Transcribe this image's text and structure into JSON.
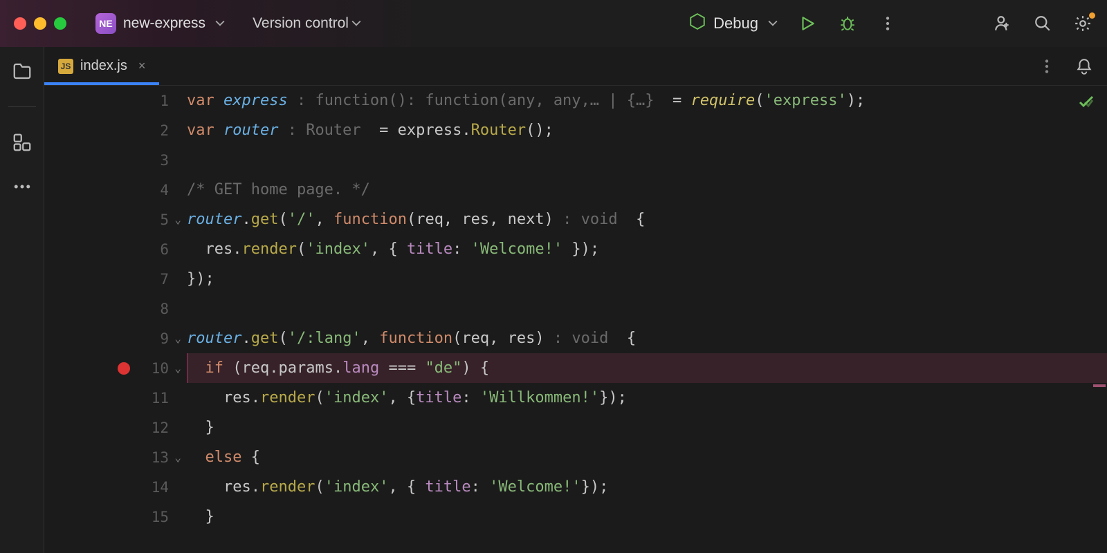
{
  "titlebar": {
    "project_badge": "NE",
    "project_name": "new-express",
    "vcs_label": "Version control",
    "debug_config": "Debug"
  },
  "tab": {
    "badge": "JS",
    "filename": "index.js"
  },
  "code": {
    "lines": [
      "1",
      "2",
      "3",
      "4",
      "5",
      "6",
      "7",
      "8",
      "9",
      "10",
      "11",
      "12",
      "13",
      "14",
      "15"
    ],
    "l1_kw": "var ",
    "l1_var": "express ",
    "l1_hint": ": function(): function(any, any,… | {…}  ",
    "l1_eq": "= ",
    "l1_fn": "require",
    "l1_paren": "(",
    "l1_str": "'express'",
    "l1_end": ");",
    "l2_kw": "var ",
    "l2_var": "router ",
    "l2_hint": ": Router  ",
    "l2_eq": "= ",
    "l2_id": "express",
    "l2_dot": ".",
    "l2_method": "Router",
    "l2_end": "();",
    "l4": "/* GET home page. */",
    "l5_var": "router",
    "l5_dot": ".",
    "l5_method": "get",
    "l5_open": "(",
    "l5_str": "'/'",
    "l5_comma": ", ",
    "l5_fn": "function",
    "l5_args": "(req, res, next) ",
    "l5_hint": ": void  ",
    "l5_brace": "{",
    "l6_indent": "  ",
    "l6_id": "res",
    "l6_dot": ".",
    "l6_method": "render",
    "l6_open": "(",
    "l6_str1": "'index'",
    "l6_comma": ", { ",
    "l6_prop": "title",
    "l6_colon": ": ",
    "l6_str2": "'Welcome!'",
    "l6_end": " });",
    "l7": "});",
    "l9_var": "router",
    "l9_dot": ".",
    "l9_method": "get",
    "l9_open": "(",
    "l9_str": "'/:lang'",
    "l9_comma": ", ",
    "l9_fn": "function",
    "l9_args": "(req, res) ",
    "l9_hint": ": void  ",
    "l9_brace": "{",
    "l10_indent": "  ",
    "l10_kw": "if ",
    "l10_open": "(",
    "l10_id": "req",
    "l10_p1": ".params.",
    "l10_prop": "lang",
    "l10_op": " === ",
    "l10_str": "\"de\"",
    "l10_close": ") {",
    "l11_indent": "    ",
    "l11_id": "res",
    "l11_dot": ".",
    "l11_method": "render",
    "l11_open": "(",
    "l11_str1": "'index'",
    "l11_comma": ", {",
    "l11_prop": "title",
    "l11_colon": ": ",
    "l11_str2": "'Willkommen!'",
    "l11_end": "});",
    "l12": "  }",
    "l13_indent": "  ",
    "l13_kw": "else ",
    "l13_brace": "{",
    "l14_indent": "    ",
    "l14_id": "res",
    "l14_dot": ".",
    "l14_method": "render",
    "l14_open": "(",
    "l14_str1": "'index'",
    "l14_comma": ", { ",
    "l14_prop": "title",
    "l14_colon": ": ",
    "l14_str2": "'Welcome!'",
    "l14_end": "});",
    "l15": "  }"
  }
}
